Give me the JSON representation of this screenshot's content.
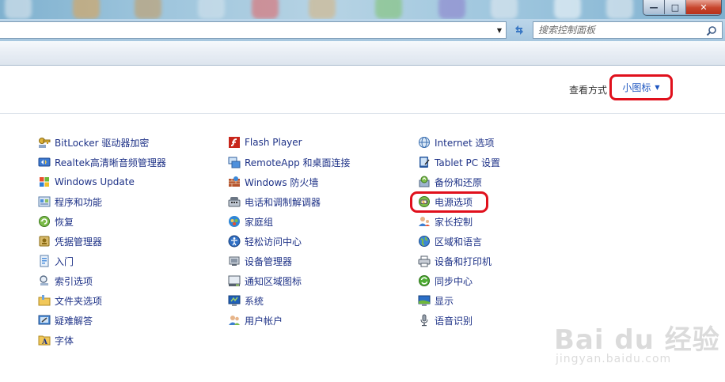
{
  "window": {
    "minimize_label": "—",
    "maximize_label": "□",
    "close_label": "✕"
  },
  "toolbar": {
    "search_placeholder": "搜索控制面板"
  },
  "view": {
    "label": "查看方式",
    "selected": "小图标"
  },
  "items": {
    "col1": [
      {
        "label": "BitLocker 驱动器加密",
        "icon": "bitlocker-key-icon"
      },
      {
        "label": "Realtek高清晰音频管理器",
        "icon": "realtek-audio-icon"
      },
      {
        "label": "Windows Update",
        "icon": "windows-update-icon"
      },
      {
        "label": "程序和功能",
        "icon": "programs-icon"
      },
      {
        "label": "恢复",
        "icon": "recovery-icon"
      },
      {
        "label": "凭据管理器",
        "icon": "credential-icon"
      },
      {
        "label": "入门",
        "icon": "getting-started-icon"
      },
      {
        "label": "索引选项",
        "icon": "indexing-icon"
      },
      {
        "label": "文件夹选项",
        "icon": "folder-options-icon"
      },
      {
        "label": "疑难解答",
        "icon": "troubleshooting-icon"
      },
      {
        "label": "字体",
        "icon": "fonts-icon"
      }
    ],
    "col2": [
      {
        "label": "Flash Player",
        "icon": "flash-player-icon"
      },
      {
        "label": "RemoteApp 和桌面连接",
        "icon": "remoteapp-icon"
      },
      {
        "label": "Windows 防火墙",
        "icon": "firewall-icon"
      },
      {
        "label": "电话和调制解调器",
        "icon": "phone-modem-icon"
      },
      {
        "label": "家庭组",
        "icon": "homegroup-icon"
      },
      {
        "label": "轻松访问中心",
        "icon": "ease-of-access-icon"
      },
      {
        "label": "设备管理器",
        "icon": "device-manager-icon"
      },
      {
        "label": "通知区域图标",
        "icon": "notification-area-icon"
      },
      {
        "label": "系统",
        "icon": "system-icon"
      },
      {
        "label": "用户帐户",
        "icon": "user-accounts-icon"
      }
    ],
    "col3": [
      {
        "label": "Internet 选项",
        "icon": "internet-options-icon"
      },
      {
        "label": "Tablet PC 设置",
        "icon": "tablet-pc-icon"
      },
      {
        "label": "备份和还原",
        "icon": "backup-restore-icon"
      },
      {
        "label": "电源选项",
        "icon": "power-options-icon"
      },
      {
        "label": "家长控制",
        "icon": "parental-controls-icon"
      },
      {
        "label": "区域和语言",
        "icon": "region-language-icon"
      },
      {
        "label": "设备和打印机",
        "icon": "devices-printers-icon"
      },
      {
        "label": "同步中心",
        "icon": "sync-center-icon"
      },
      {
        "label": "显示",
        "icon": "display-icon"
      },
      {
        "label": "语音识别",
        "icon": "speech-recognition-icon"
      }
    ]
  },
  "watermark": {
    "brand": "Bai du 经验",
    "url": "jingyan.baidu.com"
  },
  "colors": {
    "link": "#1e3287",
    "highlight": "#e0101c",
    "view_link": "#1e56c0"
  }
}
